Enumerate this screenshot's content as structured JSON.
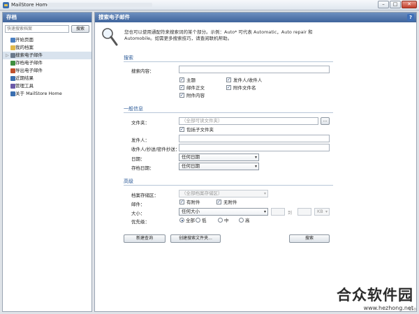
{
  "window": {
    "title": "MailStore Home"
  },
  "left": {
    "header": "存档",
    "search_placeholder": "快速搜索档案",
    "search_button": "搜索",
    "items": [
      {
        "label": "开始页面",
        "icon": "home-icon",
        "color": "#4a7fc1"
      },
      {
        "label": "我的档案",
        "icon": "folder-icon",
        "color": "#e0b84a"
      },
      {
        "label": "搜索电子邮件",
        "icon": "search-icon",
        "color": "#6b7a8c",
        "active": true
      },
      {
        "label": "存档电子邮件",
        "icon": "archive-icon",
        "color": "#3f8f3f"
      },
      {
        "label": "导出电子邮件",
        "icon": "export-icon",
        "color": "#c0502c"
      },
      {
        "label": "近期结果",
        "icon": "results-icon",
        "color": "#3b6fb0"
      },
      {
        "label": "管理工具",
        "icon": "tools-icon",
        "color": "#6b5aa8"
      },
      {
        "label": "关于 MailStore Home",
        "icon": "info-icon",
        "color": "#3b6fb0"
      }
    ]
  },
  "main": {
    "header": "搜索电子邮件",
    "intro": "您也可以使用通配符来搜索词的某个部分。示例：Auto* 可代表 Automatic，Auto repair 和 Automobile。如需更多搜索技巧，请查阅联机帮助。",
    "search_section": "搜索",
    "search_content_label": "搜索内容：",
    "checkboxes": [
      {
        "label": "主题",
        "checked": true
      },
      {
        "label": "发件人/收件人",
        "checked": true
      },
      {
        "label": "邮件正文",
        "checked": true
      },
      {
        "label": "附件文件名",
        "checked": true
      },
      {
        "label": "附件内容",
        "checked": true
      }
    ],
    "general_section": "一般信息",
    "folder_label": "文件夹：",
    "folder_value": "（全部可读文件夹）",
    "browse_button": "...",
    "include_subfolders": "包括子文件夹",
    "sender_label": "发件人：",
    "recipient_label": "收件人/抄送/密件抄送：",
    "date_label": "日期：",
    "date_value": "任何日期",
    "archive_date_label": "存档日期：",
    "archive_date_value": "任何日期",
    "advanced_section": "高级",
    "store_label": "档案存储区：",
    "store_value": "（全部档案存储区）",
    "mail_label": "邮件：",
    "has_attachment": "有附件",
    "no_attachment": "无附件",
    "size_label": "大小：",
    "size_value": "任何大小",
    "to_text": "到",
    "unit_value": "KB",
    "priority_label": "优先级：",
    "priorities": [
      "全部",
      "低",
      "中",
      "高"
    ],
    "new_query_button": "新建查询",
    "create_folder_button": "创建搜索文件夹...",
    "search_button": "搜索"
  },
  "watermark": {
    "text": "合众软件园",
    "url": "www.hezhong.net"
  },
  "version": "150"
}
